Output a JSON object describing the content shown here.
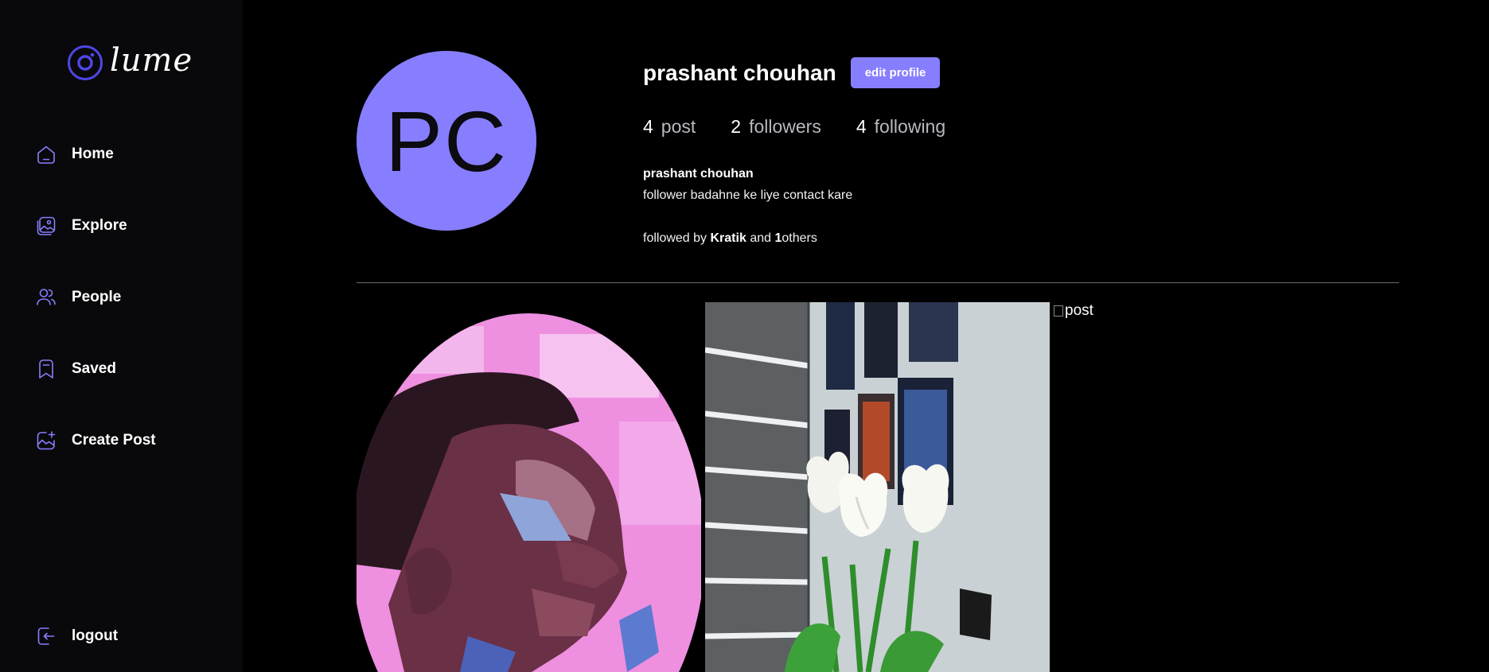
{
  "app": {
    "logo_text": "lume",
    "accent_color": "#877eff"
  },
  "sidebar": {
    "items": [
      {
        "label": "Home",
        "icon": "home-icon"
      },
      {
        "label": "Explore",
        "icon": "gallery-icon"
      },
      {
        "label": "People",
        "icon": "people-icon"
      },
      {
        "label": "Saved",
        "icon": "bookmark-icon"
      },
      {
        "label": "Create Post",
        "icon": "create-post-icon"
      }
    ],
    "logout_label": "logout"
  },
  "profile": {
    "initials": "PC",
    "name": "prashant chouhan",
    "edit_label": "edit profile",
    "stats": {
      "posts_count": "4",
      "posts_label": "post",
      "followers_count": "2",
      "followers_label": "followers",
      "following_count": "4",
      "following_label": "following"
    },
    "bio_name": "prashant chouhan",
    "bio": "follower badahne ke liye contact kare",
    "followed_by_prefix": "followed by",
    "followed_by_user": "Kratik",
    "followed_by_and": "and",
    "followed_by_count": "1",
    "followed_by_suffix": "others"
  },
  "posts": {
    "broken_alt": "post"
  }
}
